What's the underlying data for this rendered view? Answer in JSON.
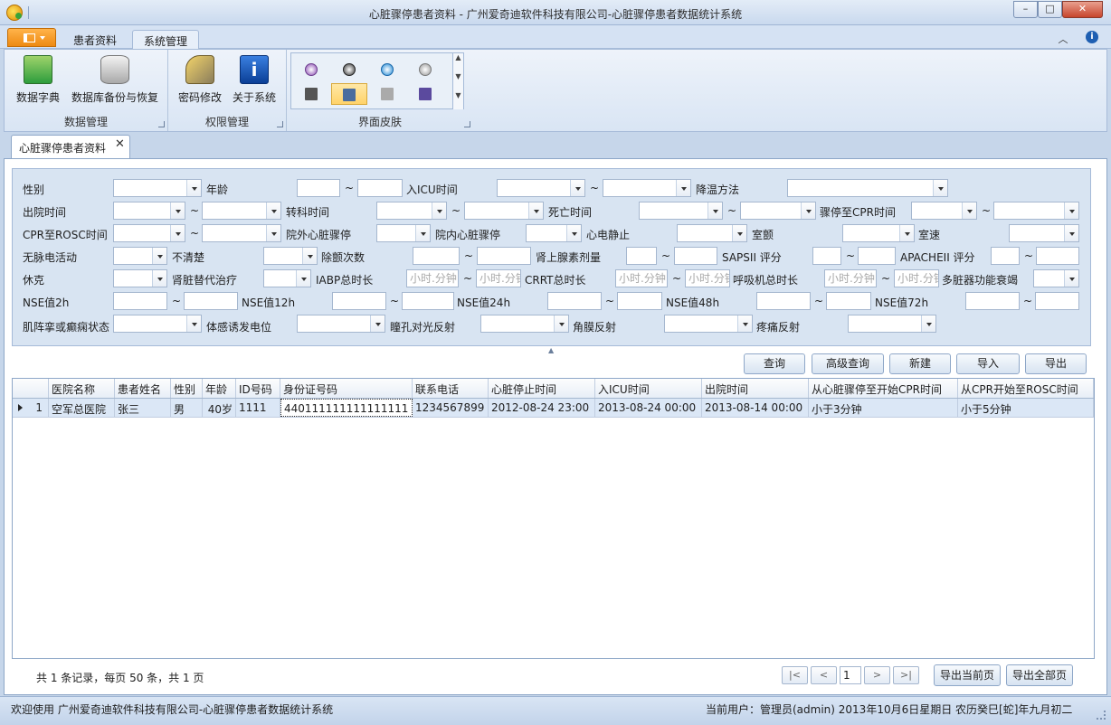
{
  "window": {
    "title": "心脏骤停患者资料 - 广州爱奇迪软件科技有限公司-心脏骤停患者数据统计系统",
    "min": "–",
    "max": "□",
    "close": "✕"
  },
  "ribbon": {
    "tabs": [
      "患者资料",
      "系统管理"
    ],
    "active_tab": "系统管理",
    "groups": [
      {
        "label": "数据管理",
        "buttons": [
          "数据字典",
          "数据库备份与恢复"
        ]
      },
      {
        "label": "权限管理",
        "buttons": [
          "密码修改",
          "关于系统"
        ]
      },
      {
        "label": "界面皮肤"
      }
    ]
  },
  "doc_tab": {
    "label": "心脏骤停患者资料",
    "close": "✕"
  },
  "filter": {
    "labels": {
      "gender": "性别",
      "age": "年龄",
      "icu_time": "入ICU时间",
      "cooling": "降温方法",
      "discharge": "出院时间",
      "transfer": "转科时间",
      "death": "死亡时间",
      "arrest_cpr": "骤停至CPR时间",
      "cpr_rosc": "CPR至ROSC时间",
      "out_arrest": "院外心脏骤停",
      "in_arrest": "院内心脏骤停",
      "ecg_silent": "心电静止",
      "vf": "室颤",
      "vt": "室速",
      "pulseless": "无脉电活动",
      "unconscious": "不清楚",
      "defib_count": "除颤次数",
      "adrenaline": "肾上腺素剂量",
      "sapsii": "SAPSII 评分",
      "apacheii": "APACHEII 评分",
      "shock": "休克",
      "renal": "肾脏替代治疗",
      "iabp": "IABP总时长",
      "crrt": "CRRT总时长",
      "vent": "呼吸机总时长",
      "mods": "多脏器功能衰竭",
      "nse2": "NSE值2h",
      "nse12": "NSE值12h",
      "nse24": "NSE值24h",
      "nse48": "NSE值48h",
      "nse72": "NSE值72h",
      "myoclonus": "肌阵挛或癫痫状态",
      "ssep": "体感诱发电位",
      "pupil": "瞳孔对光反射",
      "cornea": "角膜反射",
      "pain": "疼痛反射"
    },
    "tilde": "~",
    "time_placeholder": "小时.分钟"
  },
  "actions": [
    "查询",
    "高级查询",
    "新建",
    "导入",
    "导出"
  ],
  "grid": {
    "columns": [
      "医院名称",
      "患者姓名",
      "性别",
      "年龄",
      "ID号码",
      "身份证号码",
      "联系电话",
      "心脏停止时间",
      "入ICU时间",
      "出院时间",
      "从心脏骤停至开始CPR时间",
      "从CPR开始至ROSC时间"
    ],
    "rows": [
      {
        "index": "1",
        "cells": [
          "空军总医院",
          "张三",
          "男",
          "40岁",
          "1111",
          "440111111111111111",
          "1234567899",
          "2012-08-24 23:00",
          "2013-08-24 00:00",
          "2013-08-14 00:00",
          "小于3分钟",
          "小于5分钟"
        ]
      }
    ]
  },
  "pager": {
    "summary": "共 1 条记录，每页 50 条，共 1 页",
    "first": "|<",
    "prev": "<",
    "page": "1",
    "next": ">",
    "last": ">|",
    "export_current": "导出当前页",
    "export_all": "导出全部页"
  },
  "status": {
    "left": "欢迎使用 广州爱奇迪软件科技有限公司-心脏骤停患者数据统计系统",
    "right": "当前用户：管理员(admin)   2013年10月6日星期日 农历癸巳[蛇]年九月初二"
  }
}
